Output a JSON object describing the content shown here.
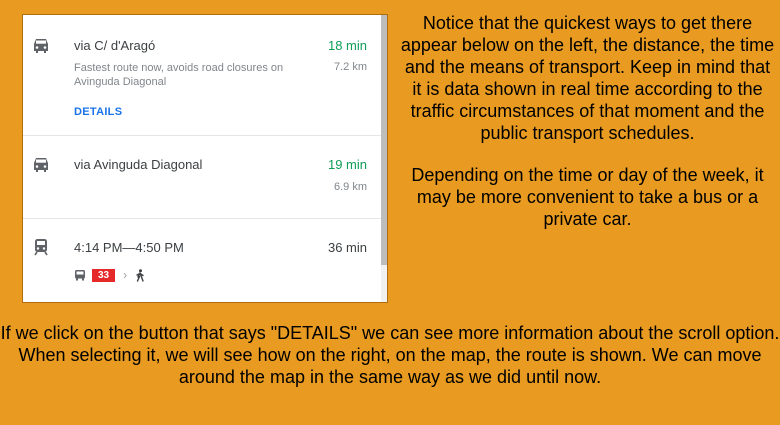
{
  "routes": [
    {
      "title": "via C/ d'Aragó",
      "time": "18 min",
      "description": "Fastest route now, avoids road closures on Avinguda Diagonal",
      "distance": "7.2 km",
      "details_label": "DETAILS",
      "time_color": "#0f9d58",
      "icon": "car-icon"
    },
    {
      "title": "via Avinguda Diagonal",
      "time": "19 min",
      "distance": "6.9 km",
      "time_color": "#0f9d58",
      "icon": "car-icon"
    },
    {
      "title": "4:14 PM—4:50 PM",
      "time": "36 min",
      "bus_line": "33",
      "bus_line_color": "#e52929",
      "icon": "train-icon",
      "steps": [
        "bus-icon",
        "chevron-right-icon",
        "walk-icon"
      ]
    }
  ],
  "explanation": {
    "paragraph1": "Notice that the quickest ways to get there appear below on the left, the distance, the time and the means of transport. Keep in mind that it is data shown in real time according to the traffic circumstances of that moment and the public transport schedules.",
    "paragraph2": "Depending on the time or day of the week, it may be more convenient to take a bus or a private car.",
    "bottom": "If we click on the button that says \"DETAILS\" we can see more information about the scroll option. When selecting it, we will see how on the right, on the map, the route is shown. We can move around the map in the same way as we did until now."
  },
  "colors": {
    "background": "#e89a21",
    "link": "#1a73e8"
  }
}
